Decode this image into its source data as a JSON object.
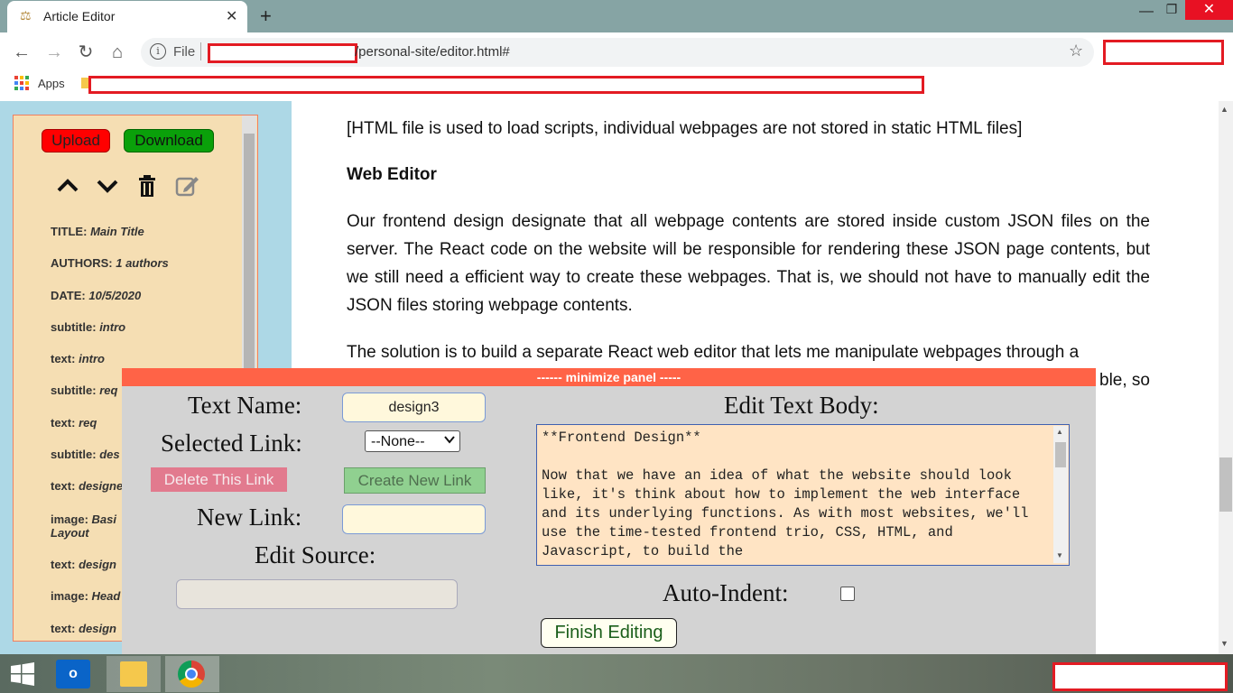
{
  "browser": {
    "tab_title": "Article Editor",
    "tab_close": "✕",
    "new_tab": "+",
    "window": {
      "minimize": "—",
      "maximize": "❐",
      "close": "✕"
    },
    "nav": {
      "back": "←",
      "forward": "→",
      "reload": "↻",
      "home": "⌂"
    },
    "address": {
      "scheme_label": "File",
      "info": "i",
      "url_visible": "/personal-site/editor.html#"
    },
    "star": "☆",
    "bookmarks": {
      "apps_label": "Apps"
    }
  },
  "article": {
    "para1": "[HTML file is used to load scripts, individual webpages are not stored in static HTML files]",
    "heading": "Web Editor",
    "para2": "Our frontend design designate that all webpage contents are stored inside custom JSON files on the server. The React code on the website will be responsible for rendering these JSON page contents, but we still need a efficient way to create these webpages. That is, we should not have to manually edit the JSON files storing webpage contents.",
    "para3_line1": "The solution is to build a separate React web editor that lets me manipulate webpages through a",
    "para3_tail": "ble, so"
  },
  "sidebar": {
    "upload_label": "Upload",
    "download_label": "Download",
    "icons": [
      "chevron-up-icon",
      "chevron-down-icon",
      "trash-icon",
      "edit-icon"
    ],
    "items": [
      {
        "key": "TITLE:",
        "value": "Main Title"
      },
      {
        "key": "AUTHORS:",
        "value": "1 authors"
      },
      {
        "key": "DATE:",
        "value": "10/5/2020"
      },
      {
        "key": "subtitle:",
        "value": "intro"
      },
      {
        "key": "text:",
        "value": "intro"
      },
      {
        "key": "subtitle:",
        "value": "req"
      },
      {
        "key": "text:",
        "value": "req"
      },
      {
        "key": "subtitle:",
        "value": "des"
      },
      {
        "key": "text:",
        "value": "designe"
      },
      {
        "key": "image:",
        "value": "Basi"
      },
      {
        "key": "",
        "value": "Layout"
      },
      {
        "key": "text:",
        "value": "design"
      },
      {
        "key": "image:",
        "value": "Head"
      },
      {
        "key": "text:",
        "value": "design"
      }
    ]
  },
  "panel": {
    "header": "------ minimize panel -----",
    "text_name_label": "Text Name:",
    "text_name_value": "design3",
    "selected_link_label": "Selected Link:",
    "selected_link_value": "--None--",
    "delete_link_label": "Delete This Link",
    "create_link_label": "Create New Link",
    "new_link_label": "New Link:",
    "new_link_value": "",
    "edit_source_label": "Edit Source:",
    "edit_source_value": "",
    "edit_body_label": "Edit Text Body:",
    "body_text": "**Frontend Design**\n\nNow that we have an idea of what the website should look like, it's think about how to implement the web interface and its underlying functions. As with most websites, we'll use the time-tested frontend trio, CSS, HTML, and Javascript, to build the",
    "auto_indent_label": "Auto-Indent:",
    "auto_indent_checked": false,
    "finish_label": "Finish Editing"
  },
  "taskbar": {
    "outlook_letter": "o",
    "apps": [
      "windows-start",
      "outlook",
      "file-explorer",
      "chrome"
    ]
  },
  "colors": {
    "upload": "#ff0000",
    "download": "#0aa00a",
    "panel_header": "#ff6347",
    "sidebar_bg": "#f5deb3",
    "page_bg": "#add8e6"
  }
}
